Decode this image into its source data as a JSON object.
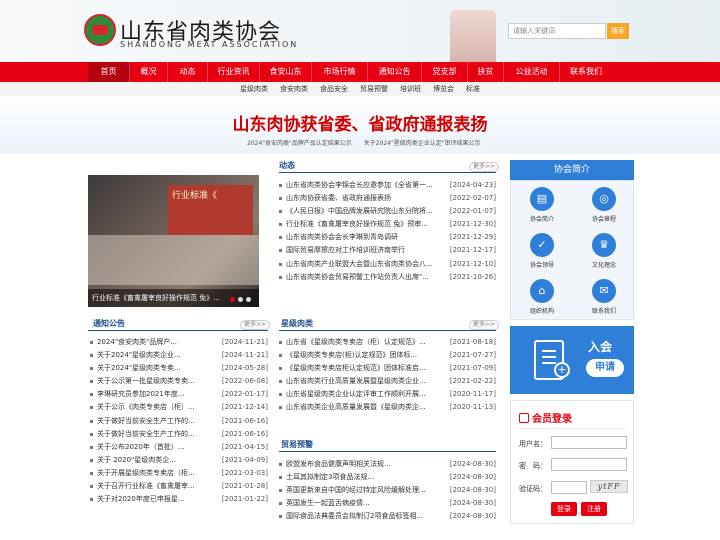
{
  "header": {
    "logo_cn": "山东省肉类协会",
    "logo_en": "SHANDONG MEAT ASSOCIATION",
    "search_placeholder": "请输入关键词",
    "search_button": "搜索"
  },
  "nav": [
    {
      "label": "首页",
      "active": true
    },
    {
      "label": "概况"
    },
    {
      "label": "动态"
    },
    {
      "label": "行业资讯"
    },
    {
      "label": "食安山东"
    },
    {
      "label": "市场行情"
    },
    {
      "label": "通知公告"
    },
    {
      "label": "党支部"
    },
    {
      "label": "扶贫"
    },
    {
      "label": "公益活动"
    },
    {
      "label": "联系我们"
    }
  ],
  "subnav": [
    "星级肉类",
    "食安肉类",
    "食品安全",
    "贸易预警",
    "培训班",
    "博览会",
    "标准"
  ],
  "headline": "山东肉协获省委、省政府通报表扬",
  "sublinks": [
    "2024\"食安肉类\"品牌产品认定结果公示",
    "关于2024\"星级肉类企业认定\"审评结果公示"
  ],
  "photo": {
    "screen_text": "行业标准《",
    "caption": "行业标准《畜禽屠宰良好操作规范 免》..."
  },
  "more_label": "更多>>",
  "dongtai": {
    "title": "动态",
    "items": [
      {
        "title": "山东省肉类协会李锦会长应邀参加《全省第一...",
        "date": "[2024-04-23]"
      },
      {
        "title": "山东肉协获省委、省政府通报表扬",
        "date": "[2022-02-07]"
      },
      {
        "title": "《人民日报》中国品牌发展研究院山东分院将...",
        "date": "[2022-01-07]"
      },
      {
        "title": "行业标准《畜禽屠宰良好操作规范 兔》预审...",
        "date": "[2021-12-30]"
      },
      {
        "title": "山东省肉类协会会长李琳到青岛调研",
        "date": "[2021-12-29]"
      },
      {
        "title": "国际贸易摩擦应对工作培训班济南举行",
        "date": "[2021-12-17]"
      },
      {
        "title": "山东省肉类产业联盟大会暨山东省肉类协会八...",
        "date": "[2021-12-10]"
      },
      {
        "title": "山东省肉类协会贸易预警工作站负责人出席\"...",
        "date": "[2021-10-26]"
      }
    ]
  },
  "notice": {
    "title": "通知公告",
    "items": [
      {
        "title": "2024\"食安肉类\"品牌产...",
        "date": "[2024-11-21]"
      },
      {
        "title": "关于2024\"星级肉类企业...",
        "date": "[2024-11-21]"
      },
      {
        "title": "关于2024\"星级肉类专卖...",
        "date": "[2024-05-28]"
      },
      {
        "title": "关于公示第一批星级肉类专卖...",
        "date": "[2022-06-08]"
      },
      {
        "title": "李琳研究员参加2021年度...",
        "date": "[2022-01-17]"
      },
      {
        "title": "关于公示《肉类专卖店（柜）...",
        "date": "[2021-12-14]"
      },
      {
        "title": "关于做好当前安全生产工作的...",
        "date": "[2021-06-16]"
      },
      {
        "title": "关于做好当前安全生产工作的...",
        "date": "[2021-06-16]"
      },
      {
        "title": "关于公布2020年（首批）...",
        "date": "[2021-04-15]"
      },
      {
        "title": "关于 2020\"星级肉类企...",
        "date": "[2021-04-09]"
      },
      {
        "title": "关于开展星级肉类专卖店（柜...",
        "date": "[2021-03-03]"
      },
      {
        "title": "关于召开行业标准《畜禽屠宰...",
        "date": "[2021-01-28]"
      },
      {
        "title": "关于对2020年度已申报星...",
        "date": "[2021-01-22]"
      }
    ]
  },
  "xingji": {
    "title": "星级肉类",
    "items": [
      {
        "title": "山东省《星级肉类专卖店（柜）认定规范》...",
        "date": "[2021-08-18]"
      },
      {
        "title": "《星级肉类专卖店(柜)认定规范》团体标...",
        "date": "[2021-07-27]"
      },
      {
        "title": "《星级肉类专卖店柜认定规范》团体标准启...",
        "date": "[2021-07-09]"
      },
      {
        "title": "山东省肉类行业高质量发展暨星级肉类企业...",
        "date": "[2021-02-22]"
      },
      {
        "title": "山东省星级肉类企业认定评审工作顺利开展...",
        "date": "[2020-11-17]"
      },
      {
        "title": "山东省肉类企业高质量发展暨《星级肉类企...",
        "date": "[2020-11-13]"
      }
    ]
  },
  "maoyi": {
    "title": "贸易预警",
    "items": [
      {
        "title": "欧盟发布食品健康声明相关法规...",
        "date": "[2024-08-30]"
      },
      {
        "title": "土耳其拟制定3项食品法规...",
        "date": "[2024-08-30]"
      },
      {
        "title": "英国更新来自中国的经过特定风险缓解处理...",
        "date": "[2024-08-30]"
      },
      {
        "title": "英国发生一起蓝舌病疫情...",
        "date": "[2024-08-30]"
      },
      {
        "title": "国际食品法典委员会拟制订2项食品标签相...",
        "date": "[2024-08-30]"
      }
    ]
  },
  "assoc": {
    "title": "协会简介",
    "icons": [
      {
        "label": "协会简介",
        "icon": "document-icon"
      },
      {
        "label": "协会章程",
        "icon": "seal-icon"
      },
      {
        "label": "协会领导",
        "icon": "check-icon"
      },
      {
        "label": "文化理念",
        "icon": "vip-icon"
      },
      {
        "label": "组织机构",
        "icon": "home-icon"
      },
      {
        "label": "联系我们",
        "icon": "mail-icon"
      }
    ]
  },
  "join": {
    "w1": "入会",
    "w2": "申请"
  },
  "login": {
    "title": "会员登录",
    "user_label": "用户名：",
    "pass_label": "密　码：",
    "captcha_label": "验证码：",
    "captcha_text": "ytFF",
    "login_btn": "登录",
    "register_btn": "注册"
  }
}
